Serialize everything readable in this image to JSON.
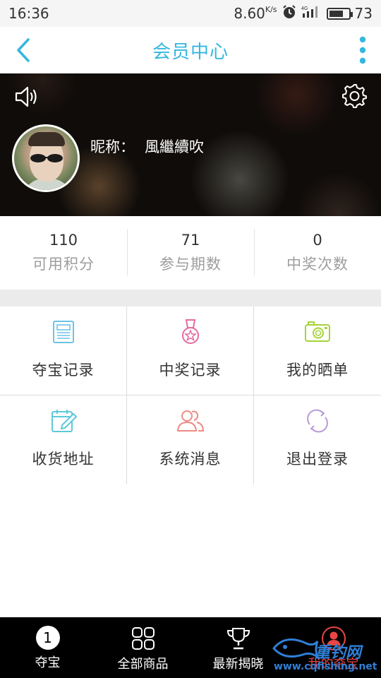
{
  "status_bar": {
    "time": "16:36",
    "speed": "8.60",
    "speed_unit": "K/s",
    "network": "4G",
    "battery": "73",
    "battery_level": 0.73
  },
  "header": {
    "title": "会员中心",
    "back_icon": "chevron-left-icon",
    "more_icon": "more-vertical-icon",
    "accent_color": "#35b7de"
  },
  "profile": {
    "nickname_label": "昵称：",
    "nickname": "風繼續吹",
    "speaker_icon": "speaker-icon",
    "settings_icon": "gear-icon"
  },
  "stats": [
    {
      "value": "110",
      "label": "可用积分"
    },
    {
      "value": "71",
      "label": "参与期数"
    },
    {
      "value": "0",
      "label": "中奖次数"
    }
  ],
  "menu": [
    {
      "label": "夺宝记录",
      "icon": "newspaper-icon",
      "color": "#6cc3e6"
    },
    {
      "label": "中奖记录",
      "icon": "medal-icon",
      "color": "#e66ba3"
    },
    {
      "label": "我的晒单",
      "icon": "camera-icon",
      "color": "#a6d33a"
    },
    {
      "label": "收货地址",
      "icon": "calendar-edit-icon",
      "color": "#5ec9d8"
    },
    {
      "label": "系统消息",
      "icon": "users-icon",
      "color": "#ef8a84"
    },
    {
      "label": "退出登录",
      "icon": "refresh-icon",
      "color": "#b79ad6"
    }
  ],
  "bottom_nav": [
    {
      "label": "夺宝",
      "icon": "badge-one-icon",
      "badge": "1"
    },
    {
      "label": "全部商品",
      "icon": "grid-icon"
    },
    {
      "label": "最新揭晓",
      "icon": "trophy-icon"
    },
    {
      "label": "我的夺宝",
      "icon": "user-icon",
      "active": true,
      "active_color": "#e94544"
    }
  ],
  "watermark": {
    "name": "重钓网",
    "url": "www.cqfishing.net"
  }
}
